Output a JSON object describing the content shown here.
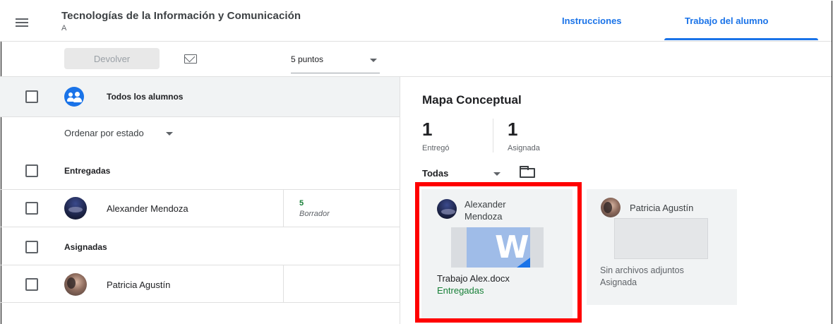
{
  "header": {
    "course_title": "Tecnologías de la Información y Comunicación",
    "course_section": "A",
    "tabs": [
      {
        "label": "Instrucciones",
        "active": false
      },
      {
        "label": "Trabajo del alumno",
        "active": true
      }
    ]
  },
  "toolbar": {
    "return_label": "Devolver",
    "points_value": "5 puntos"
  },
  "student_list": {
    "all_students_label": "Todos los alumnos",
    "sort_label": "Ordenar por estado",
    "groups": [
      {
        "label": "Entregadas",
        "students": [
          {
            "name": "Alexander Mendoza",
            "grade": "5",
            "grade_status": "Borrador"
          }
        ]
      },
      {
        "label": "Asignadas",
        "students": [
          {
            "name": "Patricia Agustín",
            "grade": "",
            "grade_status": ""
          }
        ]
      }
    ]
  },
  "assignment": {
    "title": "Mapa Conceptual",
    "stats": [
      {
        "value": "1",
        "label": "Entregó"
      },
      {
        "value": "1",
        "label": "Asignada"
      }
    ],
    "filter_label": "Todas",
    "cards": [
      {
        "student_first": "Alexander",
        "student_last": "Mendoza",
        "file_name": "Trabajo Alex.docx",
        "status": "Entregadas",
        "thumb_letter": "W"
      },
      {
        "student": "Patricia Agustín",
        "no_files": "Sin archivos adjuntos",
        "status": "Asignada"
      }
    ]
  },
  "colors": {
    "accent": "#1a73e8",
    "turned_in_green": "#188038",
    "highlight_red": "#ff0000"
  }
}
